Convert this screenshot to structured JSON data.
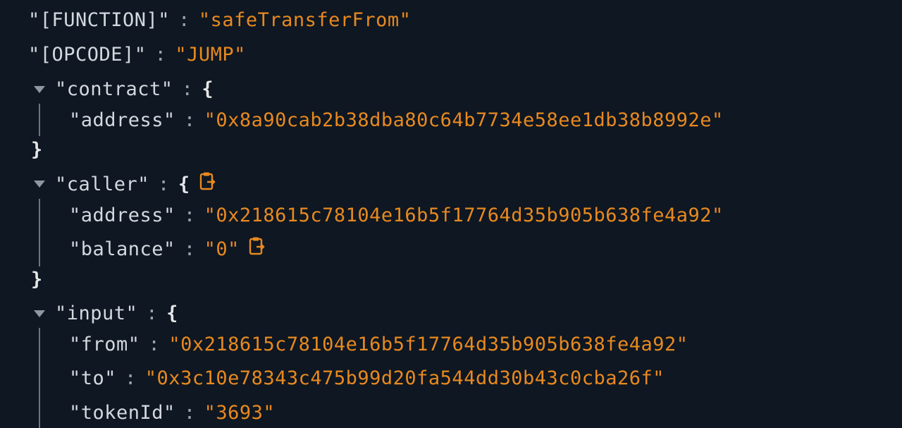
{
  "json_tree": {
    "function": {
      "key": "\"[FUNCTION]\"",
      "value": "\"safeTransferFrom\""
    },
    "opcode": {
      "key": "\"[OPCODE]\"",
      "value": "\"JUMP\""
    },
    "contract": {
      "key": "\"contract\"",
      "open": "{",
      "close": "}",
      "address": {
        "key": "\"address\"",
        "value": "\"0x8a90cab2b38dba80c64b7734e58ee1db38b8992e\""
      }
    },
    "caller": {
      "key": "\"caller\"",
      "open": "{",
      "close": "}",
      "address": {
        "key": "\"address\"",
        "value": "\"0x218615c78104e16b5f17764d35b905b638fe4a92\""
      },
      "balance": {
        "key": "\"balance\"",
        "value": "\"0\""
      }
    },
    "input": {
      "key": "\"input\"",
      "open": "{",
      "from": {
        "key": "\"from\"",
        "value": "\"0x218615c78104e16b5f17764d35b905b638fe4a92\""
      },
      "to": {
        "key": "\"to\"",
        "value": "\"0x3c10e78343c475b99d20fa544dd30b43c0cba26f\""
      },
      "tokenId": {
        "key": "\"tokenId\"",
        "value": "\"3693\""
      }
    },
    "colon": ":"
  },
  "colors": {
    "background": "#0e1722",
    "key": "#d4d8de",
    "string": "#e8891f"
  },
  "icons": {
    "toggle": "triangle-down-icon",
    "copy": "clipboard-copy-icon"
  }
}
